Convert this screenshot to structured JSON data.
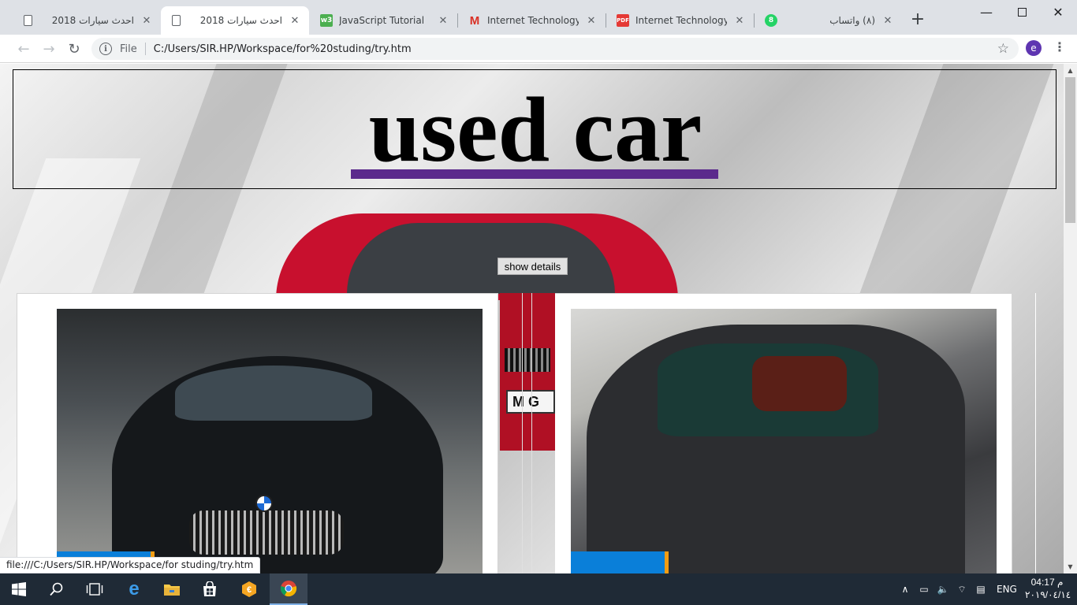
{
  "browser": {
    "tabs": [
      {
        "title": "احدث سيارات 2018",
        "rtl": true,
        "active": false
      },
      {
        "title": "احدث سيارات 2018",
        "rtl": true,
        "active": true
      },
      {
        "title": "JavaScript Tutorial",
        "rtl": false,
        "active": false
      },
      {
        "title": "Internet Technology Tas",
        "rtl": false,
        "active": false
      },
      {
        "title": "Internet Technology Tas",
        "rtl": false,
        "active": false
      },
      {
        "title": "(٨) واتساب",
        "rtl": true,
        "active": false
      }
    ],
    "whatsapp_badge": "8",
    "pdf_label": "PDF",
    "address": {
      "scheme_label": "File",
      "url": "C:/Users/SIR.HP/Workspace/for%20studing/try.htm"
    },
    "profile_initial": "e"
  },
  "page": {
    "title": "used car",
    "show_details_label": "show details",
    "plate_text": "M G"
  },
  "status_bar": {
    "url": "file:///C:/Users/SIR.HP/Workspace/for studing/try.htm"
  },
  "taskbar": {
    "time": "04:17 م",
    "date": "٢٠١٩/٠٤/١٤",
    "language": "ENG"
  },
  "colors": {
    "title_underline": "#5b2a8c",
    "red_car": "#c8102e",
    "photo_badge": "#0a7fd9",
    "avatar": "#5e35b1"
  }
}
